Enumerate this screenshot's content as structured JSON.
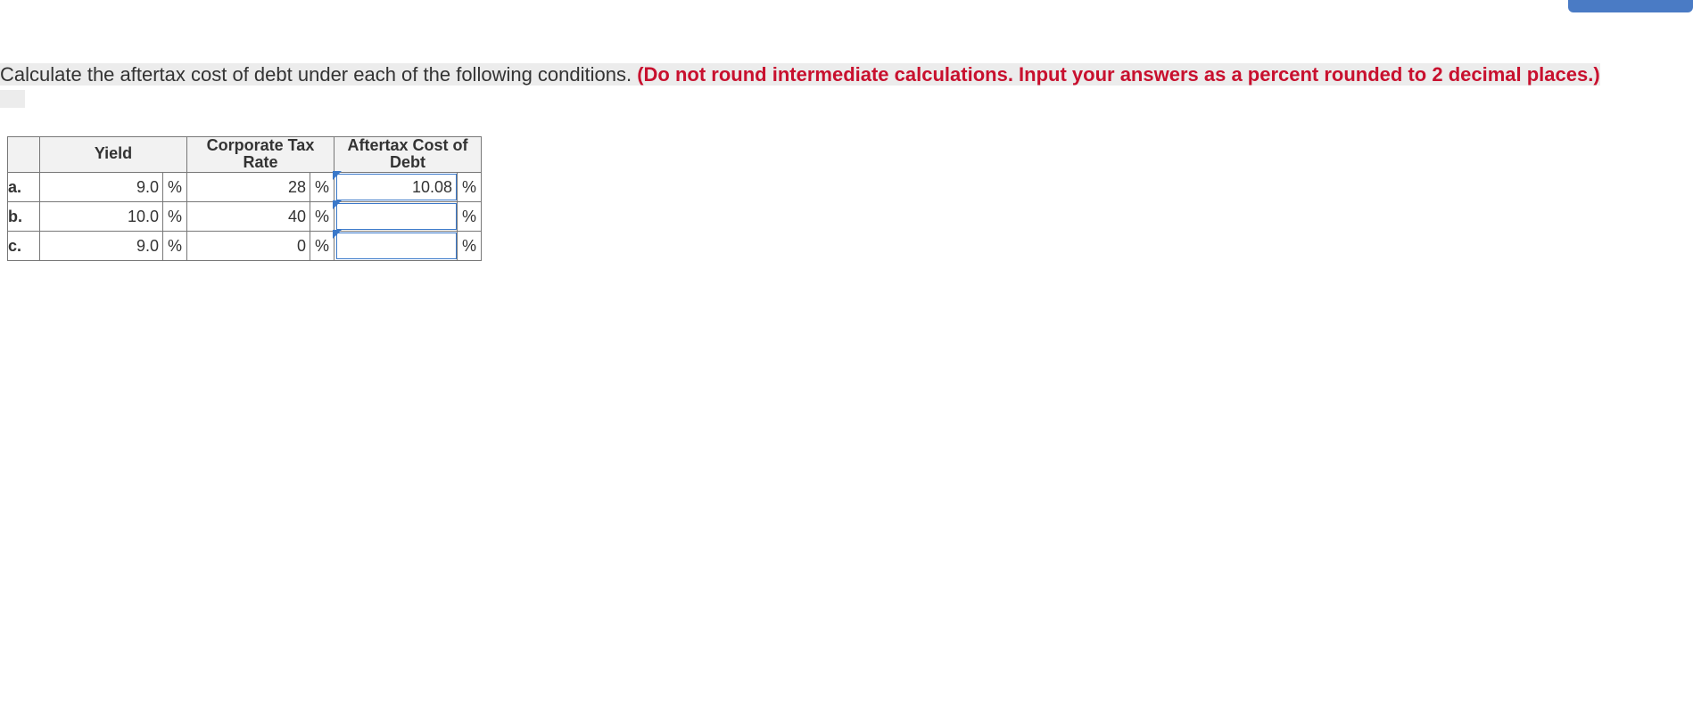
{
  "question": {
    "main": "Calculate the aftertax cost of debt under each of the following conditions. ",
    "red": "(Do not round intermediate calculations. Input your answers as a percent rounded to 2 decimal places.)"
  },
  "table": {
    "headers": {
      "yield": "Yield",
      "tax": "Corporate Tax Rate",
      "cost": "Aftertax Cost of Debt"
    },
    "unit": "%",
    "rows": [
      {
        "label": "a.",
        "yield": "9.0",
        "tax": "28",
        "cost": "10.08"
      },
      {
        "label": "b.",
        "yield": "10.0",
        "tax": "40",
        "cost": ""
      },
      {
        "label": "c.",
        "yield": "9.0",
        "tax": "0",
        "cost": ""
      }
    ]
  }
}
